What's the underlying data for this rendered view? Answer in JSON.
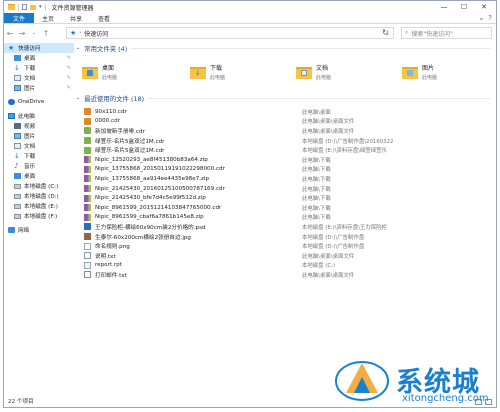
{
  "window": {
    "title": "文件资源管理器",
    "controls": [
      "—",
      "☐",
      "✕"
    ]
  },
  "ribbon": {
    "tabs": [
      "文件",
      "主页",
      "共享",
      "查看"
    ]
  },
  "address": {
    "path": "快速访问",
    "search_placeholder": "搜索\"快速访问\""
  },
  "nav": {
    "quick_access": "快速访问",
    "quick_items": [
      "桌面",
      "下载",
      "文档",
      "图片"
    ],
    "onedrive": "OneDrive",
    "this_pc": "此电脑",
    "pc_items": [
      "视频",
      "图片",
      "文档",
      "下载",
      "音乐",
      "桌面",
      "本地磁盘 (C:)",
      "本地磁盘 (D:)",
      "本地磁盘 (E:)",
      "本地磁盘 (F:)"
    ],
    "network": "网络"
  },
  "frequent": {
    "header": "常用文件夹 (4)",
    "folders": [
      {
        "name": "桌面",
        "location": "此电脑"
      },
      {
        "name": "下载",
        "location": "此电脑"
      },
      {
        "name": "文档",
        "location": "此电脑"
      },
      {
        "name": "图片",
        "location": "此电脑"
      }
    ]
  },
  "recent": {
    "header": "最近使用的文件 (18)",
    "files": [
      {
        "name": "90x110.cdr",
        "location": "此电脑\\桌面",
        "type": "cdr"
      },
      {
        "name": "0000.cdr",
        "location": "此电脑\\桌面\\桌面文件",
        "type": "cdr"
      },
      {
        "name": "新加坡新手册啡.cdr",
        "location": "此电脑\\桌面\\桌面文件",
        "type": "cdrg"
      },
      {
        "name": "绿萱乐-名片5盒双过1M.cdr",
        "location": "本地磁盘 (D:)\\广告制作盘\\20160322",
        "type": "cdrg"
      },
      {
        "name": "绿萱乐-名片5盒双过1M.cdr",
        "location": "本地磁盘 (E:)\\资料存盘\\绿萱绿萱乐",
        "type": "cdrg"
      },
      {
        "name": "Nipic_12520293_ae8f451380b83a64.zip",
        "location": "此电脑\\下载",
        "type": "zip"
      },
      {
        "name": "Nipic_13755868_20150119191022298000.cdr",
        "location": "此电脑\\下载",
        "type": "zip"
      },
      {
        "name": "Nipic_13755868_aa914ee4435e98e7.zip",
        "location": "此电脑\\下载",
        "type": "zip"
      },
      {
        "name": "Nipic_21425430_20160125100500787169.cdr",
        "location": "此电脑\\下载",
        "type": "zip"
      },
      {
        "name": "Nipic_21425430_bfe7d4c5e99f512d.zip",
        "location": "此电脑\\下载",
        "type": "zip"
      },
      {
        "name": "Nipic_8961599_20151214103847765000.cdr",
        "location": "此电脑\\下载",
        "type": "zip"
      },
      {
        "name": "Nipic_8961599_cbaf6a7861b145e8.zip",
        "location": "此电脑\\下载",
        "type": "zip"
      },
      {
        "name": "王力保险柜-横绘60x90cm装2分价格的.psd",
        "location": "本地磁盘 (E:)\\资料存盘\\王力保险柜",
        "type": "psd"
      },
      {
        "name": "生泰尔-60x200cm横绘2张册自边.jpg",
        "location": "本地磁盘 (D:)\\广告制作盘",
        "type": "jpg"
      },
      {
        "name": "命名规则.png",
        "location": "本地磁盘 (D:)\\广告制作盘",
        "type": "png"
      },
      {
        "name": "说明.txt",
        "location": "此电脑\\桌面\\桌面文件",
        "type": "txt"
      },
      {
        "name": "report.rpt",
        "location": "本地磁盘 (C:)",
        "type": "rpt"
      },
      {
        "name": "打印邮件.txt",
        "location": "此电脑\\桌面\\桌面文件",
        "type": "log"
      }
    ]
  },
  "status": {
    "count": "22 个项目"
  },
  "watermark": {
    "name": "系统城",
    "url": "xitongcheng.com"
  }
}
